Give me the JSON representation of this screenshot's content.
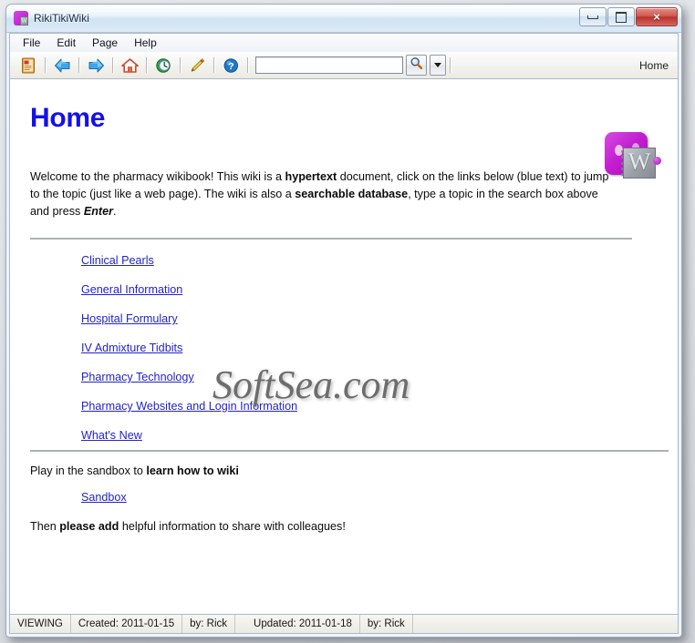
{
  "window": {
    "title": "RikiTikiWiki",
    "app_icon": "wiki-book-icon",
    "controls": {
      "minimize": "minimize-button",
      "maximize": "maximize-button",
      "close": "×"
    }
  },
  "menubar": {
    "items": [
      {
        "label": "File"
      },
      {
        "label": "Edit"
      },
      {
        "label": "Page"
      },
      {
        "label": "Help"
      }
    ]
  },
  "toolbar": {
    "buttons": [
      {
        "name": "new-page-icon",
        "tip": "New Page"
      },
      {
        "name": "back-arrow-icon",
        "tip": "Back"
      },
      {
        "name": "forward-arrow-icon",
        "tip": "Forward"
      },
      {
        "name": "home-icon",
        "tip": "Home"
      },
      {
        "name": "history-clock-icon",
        "tip": "History"
      },
      {
        "name": "edit-pencil-icon",
        "tip": "Edit"
      },
      {
        "name": "help-question-icon",
        "tip": "Help"
      }
    ],
    "search": {
      "value": "",
      "placeholder": "",
      "search_button": "search-magnifier-icon",
      "dropdown_button": "search-dropdown-icon"
    },
    "current_page_label": "Home"
  },
  "page": {
    "title": "Home",
    "intro": {
      "part1": "Welcome to the pharmacy wikibook! This wiki is a ",
      "bold1": "hypertext",
      "part2": " document, click on the links below (blue text) to jump to the topic (just like a web page). The wiki is also a ",
      "bold2": "searchable database",
      "part3": ", type a topic in the search box above and press ",
      "italic1": "Enter",
      "part4": "."
    },
    "logo_letter": "W",
    "links": [
      {
        "label": "Clinical Pearls"
      },
      {
        "label": "General Information"
      },
      {
        "label": "Hospital Formulary"
      },
      {
        "label": "IV Admixture Tidbits"
      },
      {
        "label": "Pharmacy Technology"
      },
      {
        "label": "Pharmacy Websites and Login Information"
      },
      {
        "label": "What's New"
      }
    ],
    "sandbox": {
      "text_before": "Play in the sandbox to ",
      "bold": "learn how to wiki",
      "link": "Sandbox"
    },
    "closing": {
      "before": "Then ",
      "bold": "please add",
      "after": " helpful information to share with colleagues!"
    },
    "watermark": "SoftSea.com"
  },
  "statusbar": {
    "mode": "VIEWING",
    "created_label": "Created: 2011-01-15",
    "created_by": "by: Rick",
    "updated_label": "Updated: 2011-01-18",
    "updated_by": "by: Rick"
  },
  "colors": {
    "title_link": "#1511e8",
    "link": "#2222cc",
    "logo_purple": "#c41fd2",
    "close_red": "#b8332c"
  }
}
